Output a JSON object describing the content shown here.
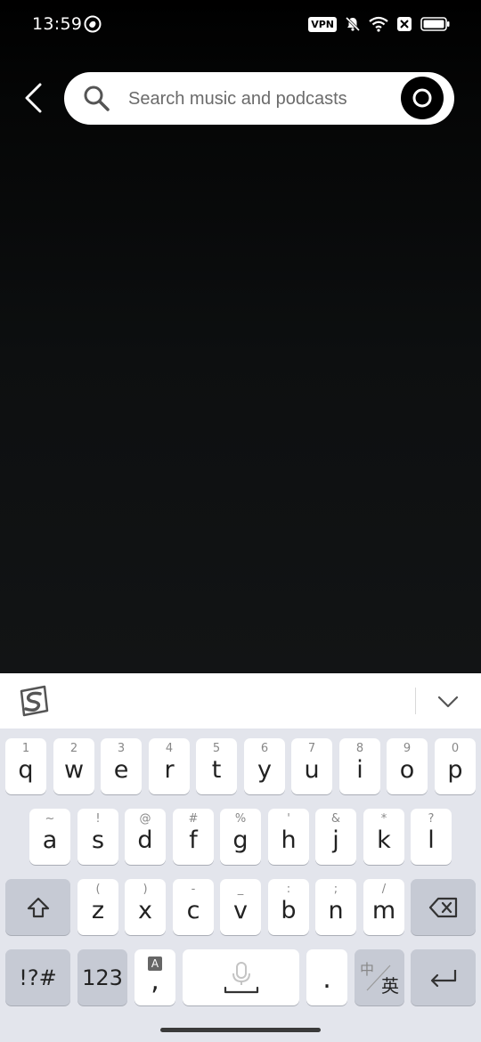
{
  "status_bar": {
    "time": "13:59",
    "vpn": "VPN",
    "icons": [
      "app-notification-icon",
      "vpn-badge",
      "mute-bell-icon",
      "wifi-icon",
      "sim-off-icon",
      "battery-icon"
    ]
  },
  "search": {
    "placeholder": "Search music and podcasts",
    "value": "",
    "icons": [
      "back-arrow-icon",
      "search-icon",
      "voice-assistant-icon"
    ]
  },
  "keyboard": {
    "toolbar_icons": [
      "sogou-logo-icon",
      "chevron-down-icon"
    ],
    "row1": [
      {
        "main": "q",
        "hint": "1"
      },
      {
        "main": "w",
        "hint": "2"
      },
      {
        "main": "e",
        "hint": "3"
      },
      {
        "main": "r",
        "hint": "4"
      },
      {
        "main": "t",
        "hint": "5"
      },
      {
        "main": "y",
        "hint": "6"
      },
      {
        "main": "u",
        "hint": "7"
      },
      {
        "main": "i",
        "hint": "8"
      },
      {
        "main": "o",
        "hint": "9"
      },
      {
        "main": "p",
        "hint": "0"
      }
    ],
    "row2": [
      {
        "main": "a",
        "hint": "~"
      },
      {
        "main": "s",
        "hint": "!"
      },
      {
        "main": "d",
        "hint": "@"
      },
      {
        "main": "f",
        "hint": "#"
      },
      {
        "main": "g",
        "hint": "%"
      },
      {
        "main": "h",
        "hint": "'"
      },
      {
        "main": "j",
        "hint": "&"
      },
      {
        "main": "k",
        "hint": "*"
      },
      {
        "main": "l",
        "hint": "?"
      }
    ],
    "row3": [
      {
        "main": "z",
        "hint": "("
      },
      {
        "main": "x",
        "hint": ")"
      },
      {
        "main": "c",
        "hint": "-"
      },
      {
        "main": "v",
        "hint": "_"
      },
      {
        "main": "b",
        "hint": ":"
      },
      {
        "main": "n",
        "hint": ";"
      },
      {
        "main": "m",
        "hint": "/"
      }
    ],
    "bottom": {
      "symbols": "!?#",
      "numbers": "123",
      "comma": ",",
      "comma_badge": "A",
      "period": ".",
      "lang_top": "中",
      "lang_bottom": "英"
    }
  },
  "colors": {
    "background": "#000000",
    "search_bar": "#ffffff",
    "keyboard_bg": "#e3e5ec",
    "func_key": "#c6cad4"
  }
}
